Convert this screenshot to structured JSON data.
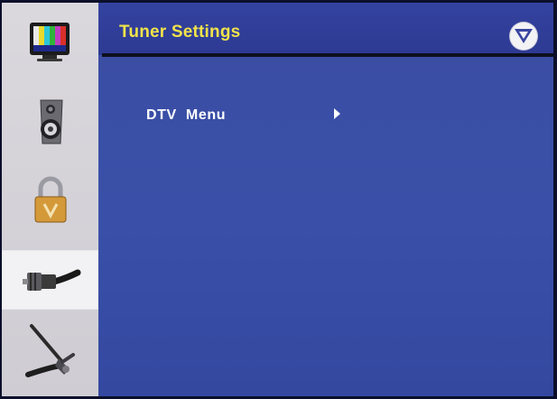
{
  "header": {
    "title": "Tuner Settings",
    "logo_icon": "vizio-v-logo-icon"
  },
  "sidebar": {
    "items": [
      {
        "name": "picture",
        "icon": "tv-color-bars-icon",
        "active": false
      },
      {
        "name": "audio",
        "icon": "speaker-icon",
        "active": false
      },
      {
        "name": "parental-lock",
        "icon": "padlock-icon",
        "active": false
      },
      {
        "name": "tuner",
        "icon": "coax-cable-icon",
        "active": true
      },
      {
        "name": "setup",
        "icon": "tools-icon",
        "active": false
      }
    ]
  },
  "menu": {
    "items": [
      {
        "label": "DTV  Menu",
        "icon": "arrow-right-icon"
      }
    ]
  },
  "colors": {
    "panel_blue": "#3a4fa6",
    "title_yellow": "#f2e34a",
    "sidebar_gray": "#d5d3d8"
  }
}
